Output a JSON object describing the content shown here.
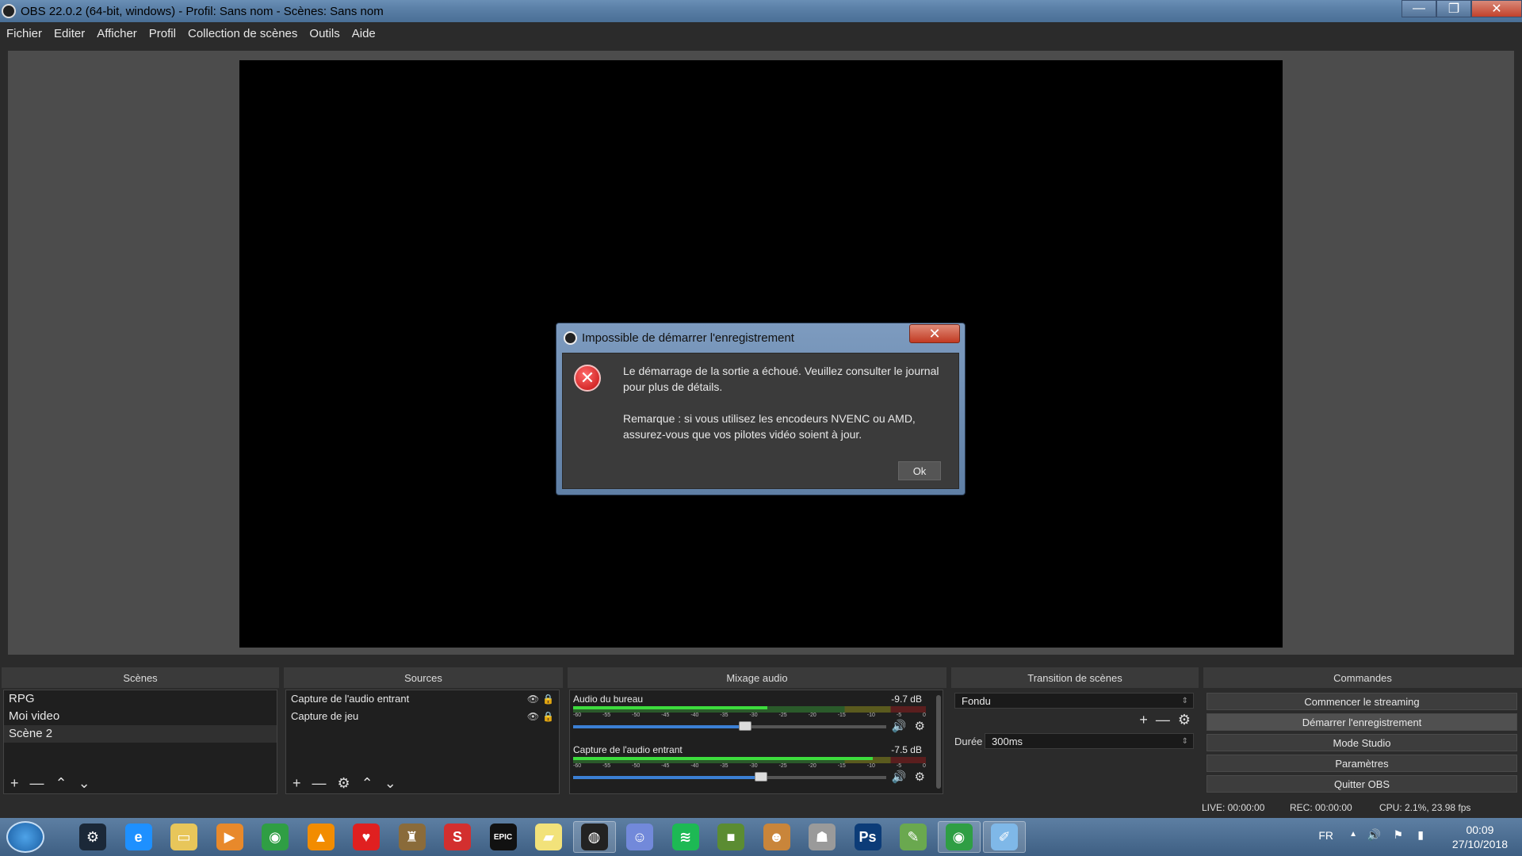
{
  "window": {
    "title": "OBS 22.0.2 (64-bit, windows) - Profil: Sans nom - Scènes: Sans nom",
    "minimize": "—",
    "maximize": "❐",
    "close": "✕"
  },
  "menu": [
    "Fichier",
    "Editer",
    "Afficher",
    "Profil",
    "Collection de scènes",
    "Outils",
    "Aide"
  ],
  "docks": {
    "scenes": {
      "title": "Scènes",
      "items": [
        "RPG",
        "Moi video",
        "Scène 2"
      ],
      "selected": "Scène 2"
    },
    "sources": {
      "title": "Sources",
      "items": [
        "Capture de l'audio entrant",
        "Capture de jeu"
      ]
    },
    "mixer": {
      "title": "Mixage audio",
      "tracks": [
        {
          "name": "Audio du bureau",
          "db": "-9.7 dB",
          "level": 0.55,
          "volume": 0.55
        },
        {
          "name": "Capture de l'audio entrant",
          "db": "-7.5 dB",
          "level": 0.85,
          "volume": 0.6
        }
      ],
      "scale": [
        "-60",
        "-55",
        "-50",
        "-45",
        "-40",
        "-35",
        "-30",
        "-25",
        "-20",
        "-15",
        "-10",
        "-5",
        "0"
      ]
    },
    "transition": {
      "title": "Transition de scènes",
      "type": "Fondu",
      "duration_label": "Durée",
      "duration": "300ms"
    },
    "controls": {
      "title": "Commandes",
      "buttons": [
        "Commencer le streaming",
        "Démarrer l'enregistrement",
        "Mode Studio",
        "Paramètres",
        "Quitter OBS"
      ]
    }
  },
  "status": {
    "live": "LIVE: 00:00:00",
    "rec": "REC: 00:00:00",
    "cpu": "CPU: 2.1%, 23.98 fps"
  },
  "dialog": {
    "title": "Impossible de démarrer l'enregistrement",
    "line1": "Le démarrage de la sortie a échoué. Veuillez consulter le journal pour plus de détails.",
    "line2": "Remarque : si vous utilisez les encodeurs NVENC ou AMD, assurez-vous que vos pilotes vidéo soient à jour.",
    "ok": "Ok",
    "close": "✕"
  },
  "taskbar": {
    "apps": [
      {
        "name": "steam-icon",
        "color": "#1b2838",
        "glyph": "⚙"
      },
      {
        "name": "internet-explorer-icon",
        "color": "#1e90ff",
        "glyph": "e"
      },
      {
        "name": "folder-icon",
        "color": "#e8c65a",
        "glyph": "▭"
      },
      {
        "name": "media-player-icon",
        "color": "#e8892b",
        "glyph": "▶"
      },
      {
        "name": "chrome-icon",
        "color": "#2f9e44",
        "glyph": "◉"
      },
      {
        "name": "vlc-icon",
        "color": "#f28c00",
        "glyph": "▲"
      },
      {
        "name": "heart-game-icon",
        "color": "#e02020",
        "glyph": "♥"
      },
      {
        "name": "game-icon",
        "color": "#8a6b3a",
        "glyph": "♜"
      },
      {
        "name": "red-app-icon",
        "color": "#d32f2f",
        "glyph": "S"
      },
      {
        "name": "epic-games-icon",
        "color": "#111111",
        "glyph": "EPIC"
      },
      {
        "name": "sticky-notes-icon",
        "color": "#f2e27a",
        "glyph": "▰"
      },
      {
        "name": "obs-icon",
        "color": "#222222",
        "glyph": "◍"
      },
      {
        "name": "discord-icon",
        "color": "#7289da",
        "glyph": "☺"
      },
      {
        "name": "spotify-icon",
        "color": "#1db954",
        "glyph": "≋"
      },
      {
        "name": "minecraft-icon",
        "color": "#5b8c32",
        "glyph": "■"
      },
      {
        "name": "anime-app-icon",
        "color": "#c9853a",
        "glyph": "☻"
      },
      {
        "name": "robot-app-icon",
        "color": "#9a9a9a",
        "glyph": "☗"
      },
      {
        "name": "photoshop-icon",
        "color": "#0c3c78",
        "glyph": "Ps"
      },
      {
        "name": "notepad-icon",
        "color": "#6aa84f",
        "glyph": "✎"
      },
      {
        "name": "chrome-active-icon",
        "color": "#2f9e44",
        "glyph": "◉"
      },
      {
        "name": "paint-icon",
        "color": "#7fb8e8",
        "glyph": "✐"
      }
    ],
    "lang": "FR",
    "time": "00:09",
    "date": "27/10/2018"
  }
}
